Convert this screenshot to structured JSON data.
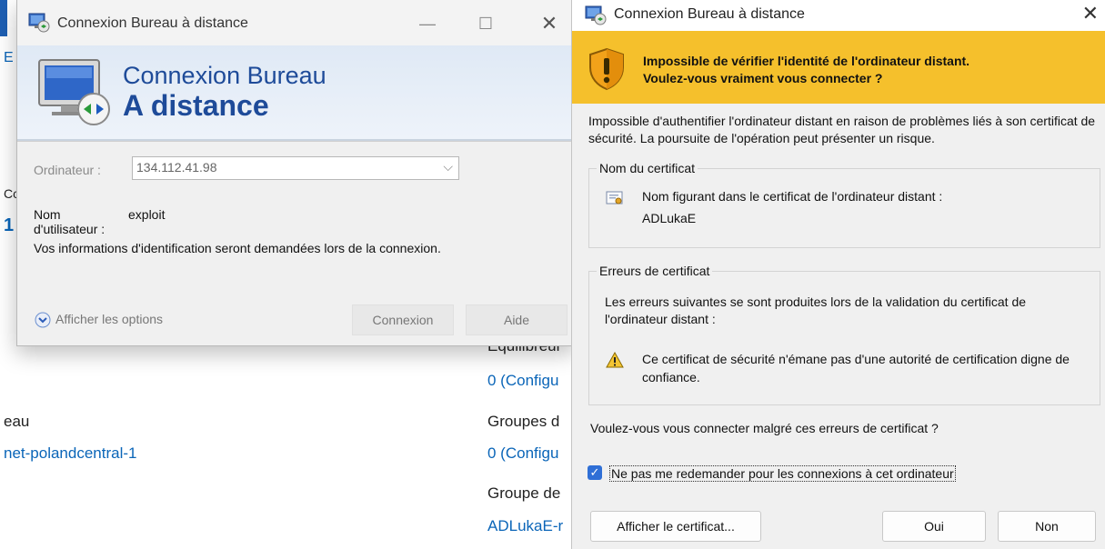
{
  "background": {
    "left_label": "eau",
    "left_link": "net-polandcentral-1",
    "right_labels": [
      "Equilibreur",
      "Groupes d",
      "Groupe de"
    ],
    "right_links": [
      "0 (Configu",
      "0 (Configu",
      "ADLukaE-r"
    ],
    "edge_fragments": [
      "E",
      "1",
      "Cc"
    ]
  },
  "rdp_dialog": {
    "title": "Connexion Bureau à distance",
    "banner_line1": "Connexion Bureau",
    "banner_line2": "A distance",
    "computer_label": "Ordinateur :",
    "computer_value": "134.112.41.98",
    "username_label": "Nom d'utilisateur :",
    "username_value": "exploit",
    "info_text": "Vos informations d'identification seront demandées lors de la connexion.",
    "options_label": "Afficher les options",
    "connect_label": "Connexion",
    "help_label": "Aide"
  },
  "cert_dialog": {
    "title": "Connexion Bureau à distance",
    "warning_line1": "Impossible de vérifier l'identité de l'ordinateur distant.",
    "warning_line2": "Voulez-vous vraiment vous connecter ?",
    "intro": "Impossible d'authentifier l'ordinateur distant en raison de problèmes liés à son certificat de sécurité. La poursuite de l'opération peut présenter un risque.",
    "cert_name_group": "Nom du certificat",
    "cert_name_line1": "Nom figurant dans le certificat de l'ordinateur distant :",
    "cert_name_line2": "ADLukaE",
    "errors_group": "Erreurs de certificat",
    "errors_desc": "Les erreurs suivantes se sont produites lors de la validation du certificat de l'ordinateur distant :",
    "error_item": "Ce certificat de sécurité n'émane pas d'une autorité de certification digne de confiance.",
    "question": "Voulez-vous vous connecter malgré ces erreurs de certificat ?",
    "checkbox_label": "Ne pas me redemander pour les connexions à cet ordinateur",
    "checkbox_checked": true,
    "view_cert_label": "Afficher le certificat...",
    "yes_label": "Oui",
    "no_label": "Non"
  },
  "colors": {
    "warning_bar": "#f5c02c",
    "banner_text": "#1e4b99",
    "link": "#0a65b8",
    "checkbox": "#2f6fd6"
  }
}
